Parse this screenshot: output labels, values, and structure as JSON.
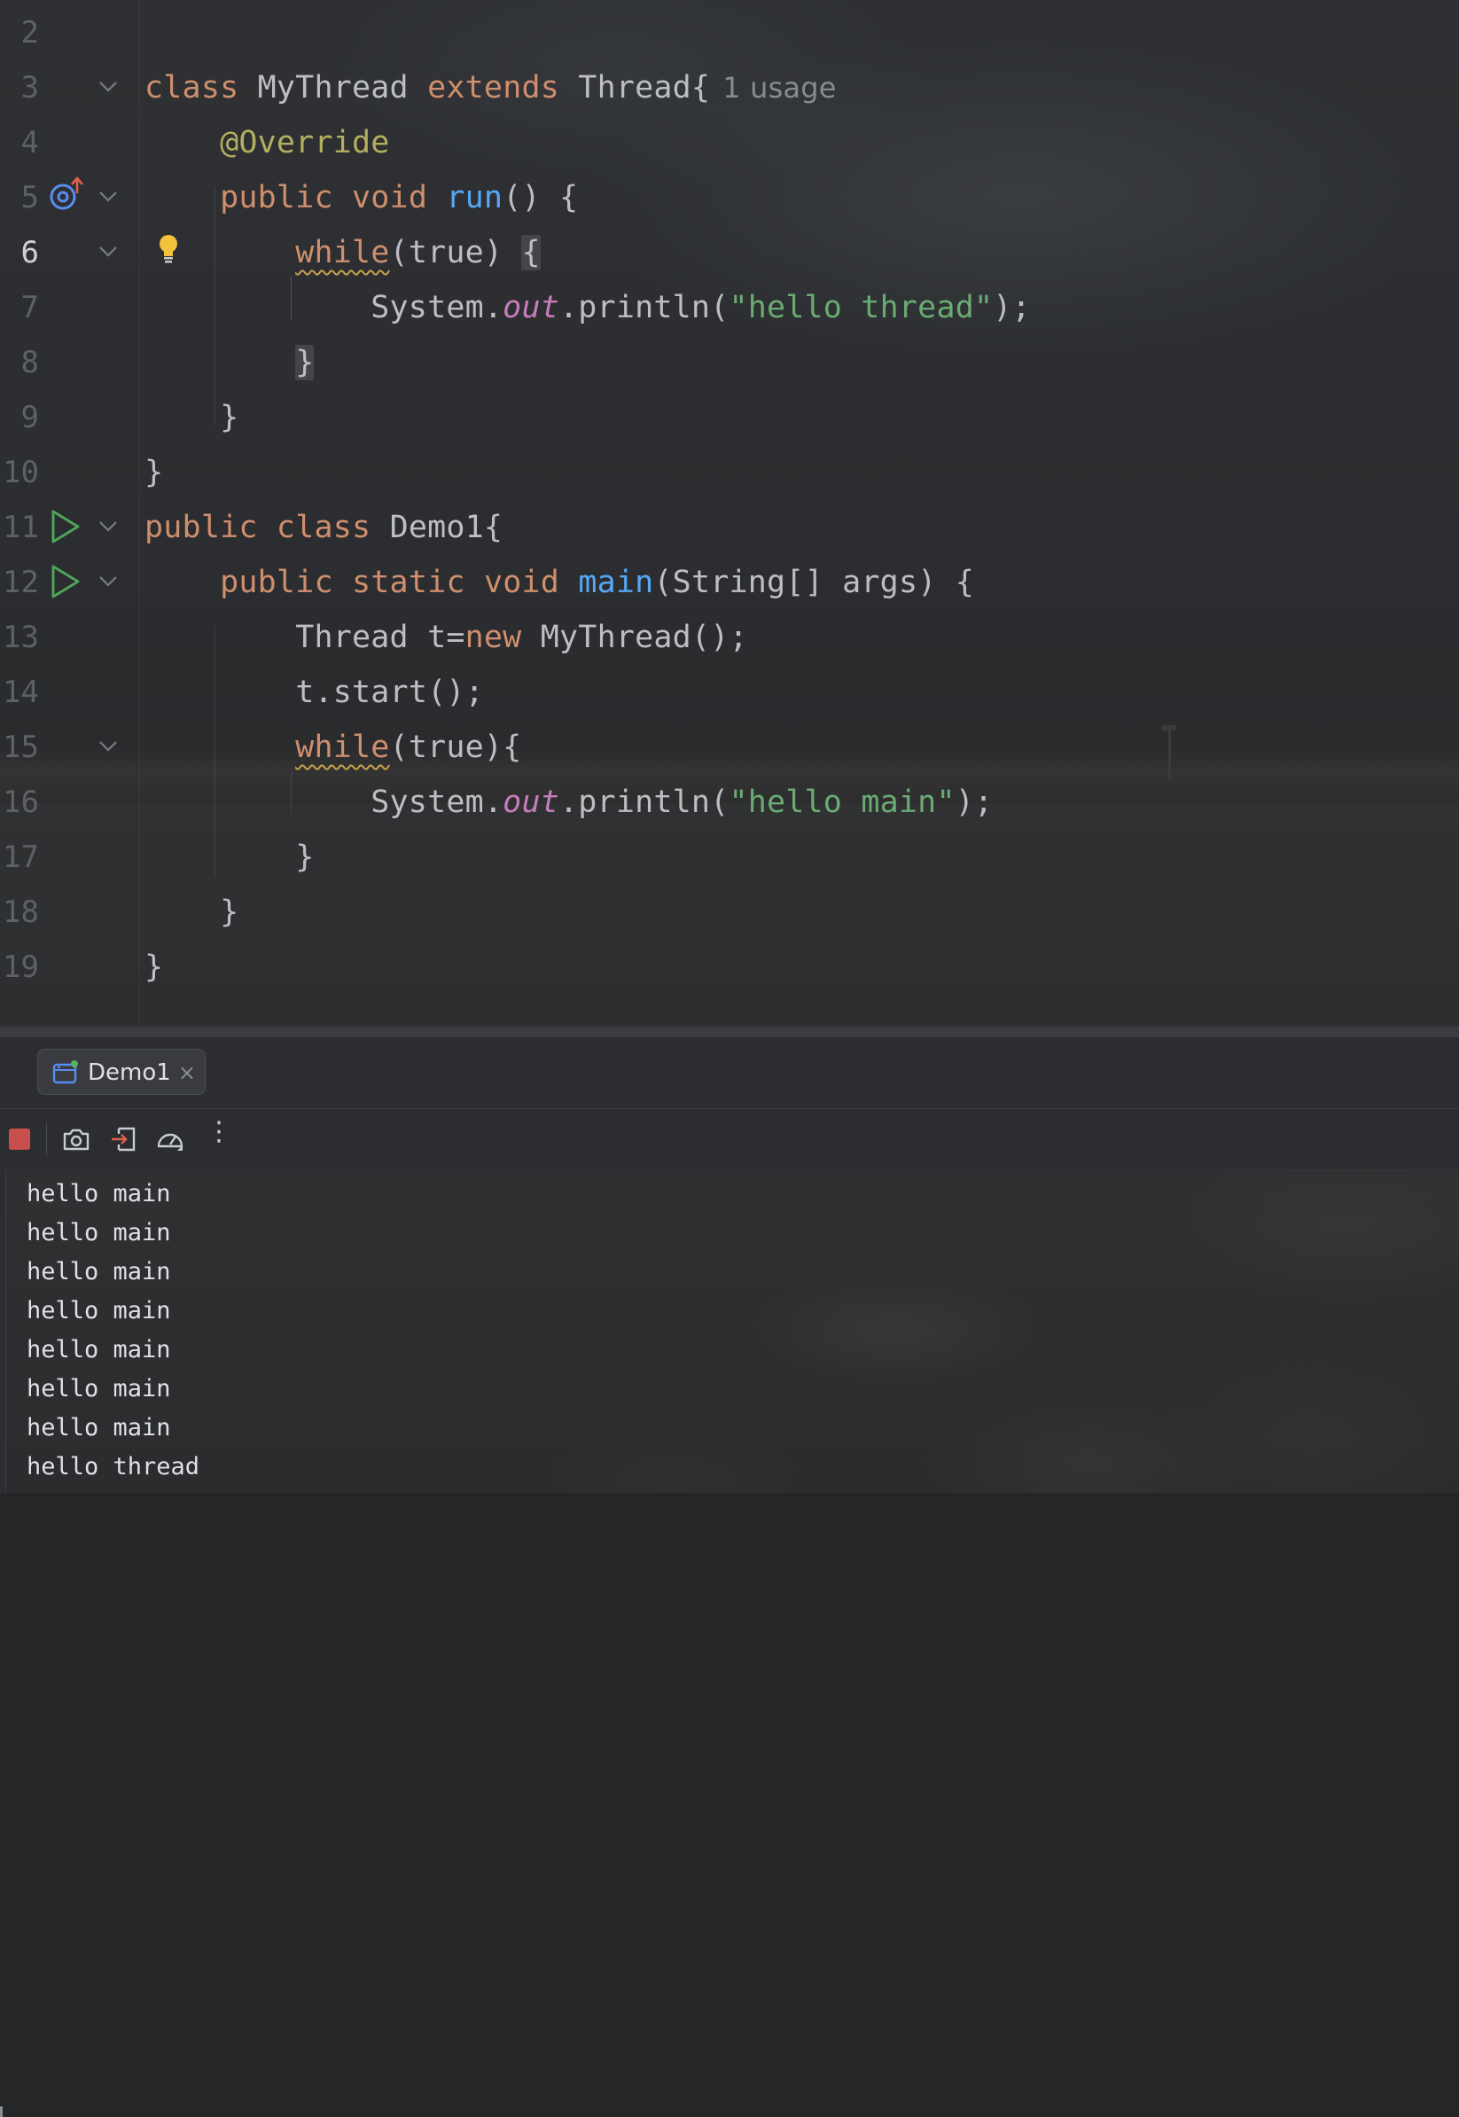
{
  "editor": {
    "lines": [
      {
        "n": "2"
      },
      {
        "n": "3"
      },
      {
        "n": "4"
      },
      {
        "n": "5"
      },
      {
        "n": "6"
      },
      {
        "n": "7"
      },
      {
        "n": "8"
      },
      {
        "n": "9"
      },
      {
        "n": "10"
      },
      {
        "n": "11"
      },
      {
        "n": "12"
      },
      {
        "n": "13"
      },
      {
        "n": "14"
      },
      {
        "n": "15"
      },
      {
        "n": "16"
      },
      {
        "n": "17"
      },
      {
        "n": "18"
      },
      {
        "n": "19"
      }
    ],
    "current_line": "6",
    "usage_hint": "1 usage",
    "tokens": {
      "class": "class",
      "MyThread": "MyThread",
      "extends": "extends",
      "Thread_brace": "Thread{",
      "override": "@Override",
      "public": "public",
      "void": "void",
      "run": "run",
      "run_paren": "() {",
      "while": "while",
      "while_paren": "(true) ",
      "open_brace": "{",
      "close_brace": "}",
      "system": "System.",
      "out": "out",
      "println": ".println(",
      "hello_thread": "\"hello thread\"",
      "stmt_end": ");",
      "public_class": "public",
      "class2": "class",
      "demo1": "Demo1{",
      "static": "static",
      "main": "main",
      "main_args": "(String[] args) {",
      "thread_decl": "Thread t=",
      "new": "new",
      "mythread_ctor": "MyThread();",
      "t_start": "t.start();",
      "while_true_brace": "(true){",
      "hello_main": "\"hello main\""
    }
  },
  "run_panel": {
    "tab_label": "Demo1",
    "tab_close": "×",
    "toolbar": {
      "stop": "stop-icon",
      "screenshot": "camera-icon",
      "exit": "exit-icon",
      "profiler": "gauge-icon",
      "more": "⋮"
    },
    "output": [
      "hello main",
      "hello main",
      "hello main",
      "hello main",
      "hello main",
      "hello main",
      "hello main",
      "hello thread"
    ]
  },
  "colors": {
    "keyword": "#cf8e6d",
    "annotation": "#b3ae60",
    "function": "#56a8f5",
    "string": "#6aab73",
    "field": "#c77dbb",
    "text": "#bcbec4",
    "run_icon": "#4fa45a",
    "stop_icon": "#c94f4f"
  }
}
